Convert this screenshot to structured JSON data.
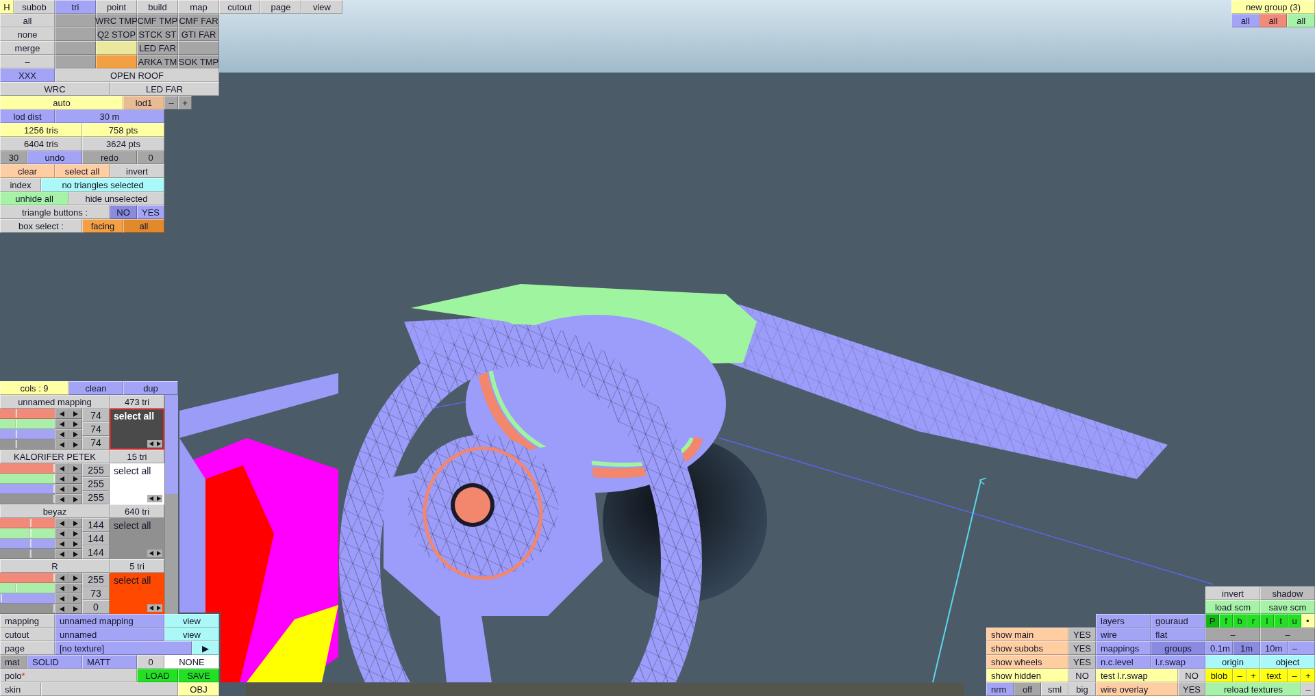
{
  "top_panel": {
    "h_button": {
      "label": "H",
      "kind": "yellow"
    },
    "tabs": [
      {
        "label": "subob",
        "selected": false
      },
      {
        "label": "tri",
        "selected": true
      },
      {
        "label": "point",
        "selected": false
      },
      {
        "label": "build",
        "selected": false
      },
      {
        "label": "map",
        "selected": false
      },
      {
        "label": "cutout",
        "selected": false
      },
      {
        "label": "page",
        "selected": false
      },
      {
        "label": "view",
        "selected": false
      }
    ],
    "strips": [
      {
        "buttons": [
          {
            "label": "all",
            "kind": "plain"
          },
          {
            "kind": "dark"
          },
          {
            "label": "WRC TMP",
            "kind": "dark"
          },
          {
            "label": "CMF TMP",
            "kind": "dark"
          },
          {
            "label": "CMF FAR",
            "kind": "dark"
          }
        ]
      },
      {
        "buttons": [
          {
            "label": "none",
            "kind": "plain"
          },
          {
            "kind": "dark"
          },
          {
            "label": "Q2 STOP",
            "kind": "dark"
          },
          {
            "label": "STCK ST",
            "kind": "dark"
          },
          {
            "label": "GTI FAR",
            "kind": "dark"
          }
        ]
      },
      {
        "buttons": [
          {
            "label": "merge",
            "kind": "plain"
          },
          {
            "kind": "dark"
          },
          {
            "kind": "pale-yellow"
          },
          {
            "label": "LED FAR",
            "kind": "dark"
          },
          {
            "kind": "dark"
          }
        ]
      },
      {
        "buttons": [
          {
            "label": "–",
            "kind": "plain"
          },
          {
            "kind": "dark"
          },
          {
            "kind": "orange"
          },
          {
            "label": "ARKA TM",
            "kind": "dark"
          },
          {
            "label": "SOK TMP",
            "kind": "dark"
          }
        ]
      },
      {
        "buttons": [
          {
            "label": "XXX",
            "kind": "blue"
          },
          {
            "label": "OPEN ROOF",
            "kind": "plain"
          }
        ]
      },
      {
        "buttons": [
          {
            "label": "WRC",
            "kind": "plain"
          },
          {
            "label": "LED FAR",
            "kind": "plain"
          }
        ]
      },
      {
        "buttons": [
          {
            "label": "auto",
            "kind": "yellow"
          },
          {
            "label": "lod1",
            "kind": "tan"
          },
          {
            "label": "–",
            "kind": "dark"
          },
          {
            "label": "+",
            "kind": "dark"
          }
        ]
      },
      {
        "buttons": [
          {
            "label": "lod dist",
            "kind": "blue"
          },
          {
            "label": "30 m",
            "kind": "blue"
          }
        ]
      },
      {
        "buttons": [
          {
            "label": "1256 tris",
            "kind": "yellow"
          },
          {
            "label": "758 pts",
            "kind": "yellow"
          }
        ]
      },
      {
        "buttons": [
          {
            "label": "6404 tris",
            "kind": "plain"
          },
          {
            "label": "3624 pts",
            "kind": "plain"
          }
        ]
      },
      {
        "buttons": [
          {
            "label": "30",
            "kind": "dark"
          },
          {
            "label": "undo",
            "kind": "blue"
          },
          {
            "label": "redo",
            "kind": "dark"
          },
          {
            "label": "0",
            "kind": "dark"
          }
        ]
      },
      {
        "buttons": [
          {
            "label": "clear",
            "kind": "peach"
          },
          {
            "label": "select all",
            "kind": "peach"
          },
          {
            "label": "invert",
            "kind": "plain"
          }
        ]
      },
      {
        "buttons": [
          {
            "label": "index",
            "kind": "plain"
          },
          {
            "label": "no triangles selected",
            "kind": "cyan"
          }
        ]
      },
      {
        "buttons": [
          {
            "label": "unhide all",
            "kind": "green"
          },
          {
            "label": "hide unselected",
            "kind": "plain"
          }
        ]
      },
      {
        "buttons": [
          {
            "label": "triangle buttons :",
            "kind": "plain"
          },
          {
            "label": "NO",
            "kind": "blue-on"
          },
          {
            "label": "YES",
            "kind": "blue"
          }
        ]
      },
      {
        "buttons": [
          {
            "label": "box select :",
            "kind": "plain"
          },
          {
            "label": "facing",
            "kind": "orange"
          },
          {
            "label": "all",
            "kind": "orange-on"
          }
        ]
      }
    ]
  },
  "group_panel": {
    "title": {
      "label": "new group (3)",
      "kind": "yellow"
    },
    "filters": [
      {
        "label": "all",
        "kind": "blue"
      },
      {
        "label": "all",
        "kind": "salmon"
      },
      {
        "label": "all",
        "kind": "green"
      }
    ]
  },
  "colors_panel": {
    "header": [
      {
        "label": "cols : 9",
        "kind": "yellow"
      },
      {
        "label": "clean",
        "kind": "blue"
      },
      {
        "label": "dup",
        "kind": "blue"
      }
    ],
    "entries": [
      {
        "name": "unnamed mapping",
        "tri_count": "473 tri",
        "selected": true,
        "color": "#4a4a4a",
        "action": "select all",
        "values": [
          "74",
          "74",
          "74"
        ],
        "sliders": [
          {
            "kind": "red",
            "level": 0.29
          },
          {
            "kind": "green",
            "level": 0.29
          },
          {
            "kind": "blue",
            "level": 0.29
          },
          {
            "kind": "gray",
            "level": 0.29
          }
        ]
      },
      {
        "name": "KALORIFER PETEK",
        "tri_count": "15 tri",
        "selected": false,
        "color": "#ffffff",
        "action": "select all",
        "values": [
          "255",
          "255",
          "255"
        ],
        "sliders": [
          {
            "kind": "red",
            "level": 1
          },
          {
            "kind": "green",
            "level": 1
          },
          {
            "kind": "blue",
            "level": 1
          },
          {
            "kind": "gray",
            "level": 1
          }
        ]
      },
      {
        "name": "beyaz",
        "tri_count": "640 tri",
        "selected": false,
        "color": "#909090",
        "action": "select all",
        "values": [
          "144",
          "144",
          "144"
        ],
        "sliders": [
          {
            "kind": "red",
            "level": 0.56
          },
          {
            "kind": "green",
            "level": 0.56
          },
          {
            "kind": "blue",
            "level": 0.56
          },
          {
            "kind": "gray",
            "level": 0.56
          }
        ]
      },
      {
        "name": "R",
        "tri_count": "5 tri",
        "selected": false,
        "color": "#ff4900",
        "action": "select all",
        "values": [
          "255",
          "73",
          "0"
        ],
        "sliders": [
          {
            "kind": "red",
            "level": 1
          },
          {
            "kind": "green",
            "level": 0.29
          },
          {
            "kind": "blue",
            "level": 0
          },
          {
            "kind": "gray",
            "level": 1
          }
        ]
      }
    ]
  },
  "material_panel": {
    "strips": [
      {
        "buttons": [
          {
            "label": "mapping",
            "kind": "plain"
          },
          {
            "label": "unnamed mapping",
            "kind": "blue"
          },
          {
            "label": "view",
            "kind": "cyan"
          }
        ]
      },
      {
        "buttons": [
          {
            "label": "cutout",
            "kind": "plain"
          },
          {
            "label": "unnamed",
            "kind": "blue"
          },
          {
            "label": "view",
            "kind": "cyan"
          }
        ]
      },
      {
        "buttons": [
          {
            "label": "page",
            "kind": "plain"
          },
          {
            "label": "[no texture]",
            "kind": "blue"
          },
          {
            "label": "▶",
            "kind": "cyan"
          }
        ]
      },
      {
        "buttons": [
          {
            "label": "mat",
            "kind": "dark"
          },
          {
            "label": "SOLID",
            "kind": "blue"
          },
          {
            "label": "MATT",
            "kind": "blue"
          },
          {
            "label": "0",
            "kind": "plain"
          },
          {
            "label": "NONE",
            "kind": "white"
          }
        ]
      },
      {
        "buttons": [
          {
            "label": "polo",
            "modified_marker": "*",
            "kind": "plain"
          },
          {
            "label": "LOAD",
            "kind": "bright-green"
          },
          {
            "label": "SAVE",
            "kind": "bright-green"
          }
        ]
      },
      {
        "buttons": [
          {
            "label": "skin",
            "kind": "plain"
          },
          {
            "kind": "plain"
          },
          {
            "label": "OBJ",
            "kind": "yellow"
          }
        ]
      }
    ]
  },
  "view_panel": {
    "strips": [
      {
        "buttons": [
          {
            "label": "invert",
            "kind": "plain"
          },
          {
            "label": "shadow",
            "kind": "mid"
          }
        ]
      },
      {
        "buttons": [
          {
            "label": "load scm",
            "kind": "green"
          },
          {
            "label": "save scm",
            "kind": "green"
          }
        ]
      },
      {
        "buttons": [
          {
            "label": "layers",
            "kind": "blue"
          },
          {
            "label": "gouraud",
            "kind": "blue"
          },
          {
            "label": "P",
            "kind": "bright-green-on"
          },
          {
            "label": "f",
            "kind": "bright-green"
          },
          {
            "label": "b",
            "kind": "bright-green"
          },
          {
            "label": "r",
            "kind": "bright-green"
          },
          {
            "label": "l",
            "kind": "bright-green"
          },
          {
            "label": "t",
            "kind": "bright-green"
          },
          {
            "label": "u",
            "kind": "bright-green"
          },
          {
            "label": "•",
            "kind": "yellow"
          }
        ]
      },
      {
        "buttons": [
          {
            "label": "show main",
            "kind": "peach"
          },
          {
            "label": "YES",
            "kind": "mid"
          },
          {
            "label": "wire",
            "kind": "blue"
          },
          {
            "label": "flat",
            "kind": "blue"
          },
          {
            "label": "–",
            "kind": "dark"
          },
          {
            "label": "–",
            "kind": "dark"
          }
        ]
      },
      {
        "buttons": [
          {
            "label": "show subobs",
            "kind": "peach"
          },
          {
            "label": "YES",
            "kind": "mid"
          },
          {
            "label": "mappings",
            "kind": "blue"
          },
          {
            "label": "groups",
            "kind": "blue-on"
          },
          {
            "label": "0.1m",
            "kind": "blue"
          },
          {
            "label": "1m",
            "kind": "blue-on"
          },
          {
            "label": "10m",
            "kind": "blue"
          },
          {
            "label": "–",
            "kind": "blue"
          }
        ]
      },
      {
        "buttons": [
          {
            "label": "show wheels",
            "kind": "peach"
          },
          {
            "label": "YES",
            "kind": "mid"
          },
          {
            "label": "n.c.level",
            "kind": "blue"
          },
          {
            "label": "l.r.swap",
            "kind": "blue"
          },
          {
            "label": "origin",
            "kind": "cyan"
          },
          {
            "label": "object",
            "kind": "cyan"
          }
        ]
      },
      {
        "buttons": [
          {
            "label": "show hidden",
            "kind": "yellow"
          },
          {
            "label": "NO",
            "kind": "plain"
          },
          {
            "label": "test l.r.swap",
            "kind": "yellow"
          },
          {
            "label": "NO",
            "kind": "plain"
          },
          {
            "label": "blob",
            "kind": "vivid-yellow"
          },
          {
            "label": "–",
            "kind": "vivid-yellow"
          },
          {
            "label": "+",
            "kind": "vivid-yellow"
          },
          {
            "label": "text",
            "kind": "vivid-yellow"
          },
          {
            "label": "–",
            "kind": "vivid-yellow"
          },
          {
            "label": "+",
            "kind": "vivid-yellow"
          }
        ]
      },
      {
        "buttons": [
          {
            "label": "nrm",
            "kind": "blue"
          },
          {
            "label": "off",
            "kind": "dark"
          },
          {
            "label": "sml",
            "kind": "plain"
          },
          {
            "label": "big",
            "kind": "plain"
          },
          {
            "label": "wire overlay",
            "kind": "peach"
          },
          {
            "label": "YES",
            "kind": "mid"
          },
          {
            "label": "reload textures",
            "kind": "green"
          },
          {
            "label": "–",
            "kind": "plain"
          }
        ]
      }
    ]
  }
}
